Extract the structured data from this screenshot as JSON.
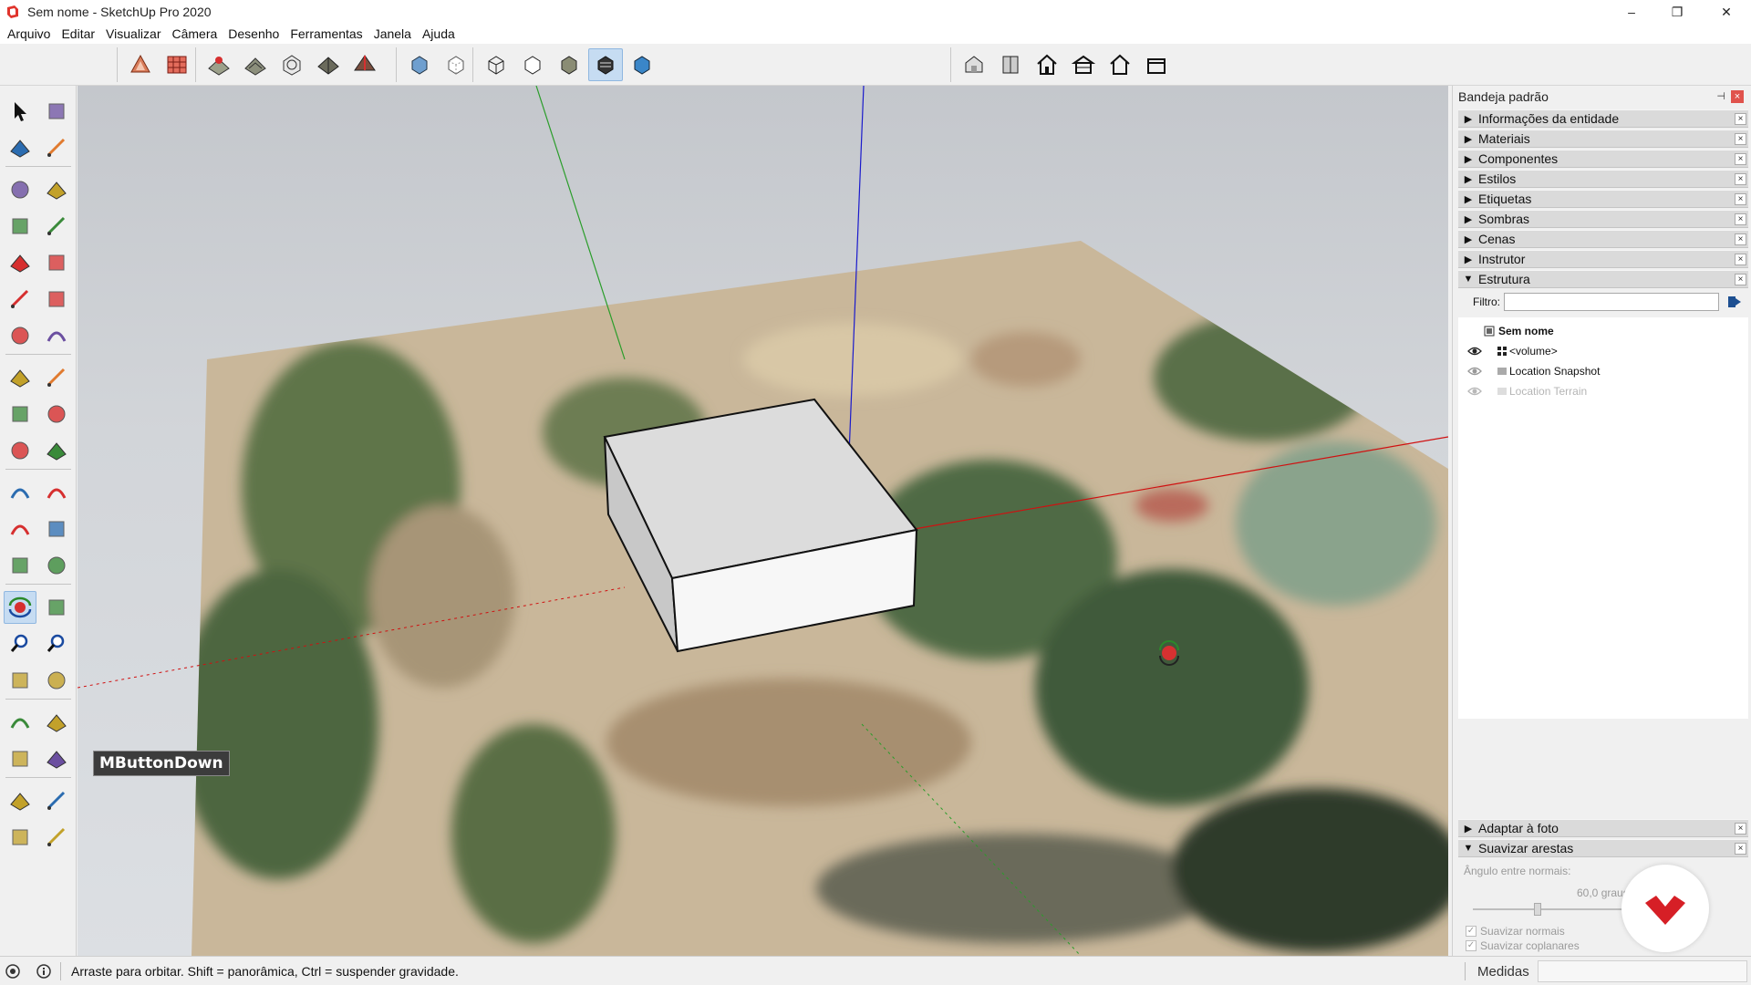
{
  "window": {
    "title": "Sem nome - SketchUp Pro 2020",
    "minimize": "–",
    "restore": "❐",
    "close": "✕"
  },
  "menu": [
    "Arquivo",
    "Editar",
    "Visualizar",
    "Câmera",
    "Desenho",
    "Ferramentas",
    "Janela",
    "Ajuda"
  ],
  "toolbar": {
    "groups": [
      [
        "warehouse-icon",
        "extension-icon"
      ],
      [
        "add-location-icon",
        "terrain-icon",
        "photo-texture-icon",
        "geo-model-icon",
        "preview-icon"
      ],
      [
        "xray-icon",
        "back-edges-icon"
      ],
      [
        "wireframe-icon",
        "hidden-line-icon",
        "shaded-icon",
        "shaded-textures-icon",
        "monochrome-icon"
      ],
      [
        "iso-view-icon",
        "top-view-icon",
        "front-view-icon",
        "right-view-icon",
        "back-view-icon",
        "left-view-icon"
      ]
    ],
    "active_icon": "shaded-textures-icon"
  },
  "left_tools": [
    [
      "select-icon",
      "make-component-icon"
    ],
    [
      "paint-bucket-icon",
      "eraser-icon"
    ],
    [
      "line-icon",
      "freehand-icon"
    ],
    [
      "rectangle-icon",
      "rotated-rectangle-icon"
    ],
    [
      "circle-icon",
      "polygon-icon"
    ],
    [
      "arc-icon",
      "two-point-arc-icon"
    ],
    [
      "three-point-arc-icon",
      "pie-icon"
    ],
    [
      "move-icon",
      "push-pull-icon"
    ],
    [
      "rotate-icon",
      "follow-me-icon"
    ],
    [
      "scale-icon",
      "offset-icon"
    ],
    [
      "tape-measure-icon",
      "dimension-icon"
    ],
    [
      "protractor-icon",
      "text-icon"
    ],
    [
      "axes-icon",
      "3d-text-icon"
    ],
    [
      "orbit-icon",
      "pan-icon"
    ],
    [
      "zoom-icon",
      "zoom-window-icon"
    ],
    [
      "zoom-extents-icon",
      "previous-view-icon"
    ],
    [
      "position-camera-icon",
      "look-around-icon"
    ],
    [
      "walk-icon",
      "section-plane-icon"
    ],
    [
      "warehouse-3d-icon",
      "share-model-icon"
    ],
    [
      "send-to-layout-icon",
      "extension-warehouse-icon"
    ]
  ],
  "left_active": "orbit-icon",
  "viewport": {
    "overlay_label": "MButtonDown"
  },
  "tray": {
    "title": "Bandeja padrão",
    "pin": "⊣",
    "close": "×",
    "panels_top": [
      {
        "label": "Informações da entidade",
        "open": false
      },
      {
        "label": "Materiais",
        "open": false
      },
      {
        "label": "Componentes",
        "open": false
      },
      {
        "label": "Estilos",
        "open": false
      },
      {
        "label": "Etiquetas",
        "open": false
      },
      {
        "label": "Sombras",
        "open": false
      },
      {
        "label": "Cenas",
        "open": false
      },
      {
        "label": "Instrutor",
        "open": false
      },
      {
        "label": "Estrutura",
        "open": true
      }
    ],
    "filter_label": "Filtro:",
    "filter_value": "",
    "outliner": {
      "root": "Sem nome",
      "items": [
        {
          "label": "<volume>",
          "visible": true,
          "dim": false
        },
        {
          "label": "Location Snapshot",
          "visible": true,
          "dim": false
        },
        {
          "label": "Location Terrain",
          "visible": false,
          "dim": true
        }
      ]
    },
    "panels_bottom": [
      {
        "label": "Adaptar à foto",
        "open": false
      },
      {
        "label": "Suavizar arestas",
        "open": true
      }
    ],
    "smooth": {
      "angle_label": "Ângulo entre normais:",
      "angle_value": "60,0  graus",
      "angle_fraction": 0.3,
      "smooth_normals": "Suavizar normais",
      "soften_coplanar": "Suavizar coplanares"
    }
  },
  "status": {
    "hint": "Arraste para orbitar. Shift = panorâmica, Ctrl = suspender gravidade.",
    "measures_label": "Medidas",
    "measures_value": ""
  },
  "colors": {
    "accent_active": "#c6dcf2",
    "axis_red": "#d01010",
    "axis_green": "#20a020",
    "axis_blue": "#1010c0",
    "brand_red": "#d61f26"
  }
}
